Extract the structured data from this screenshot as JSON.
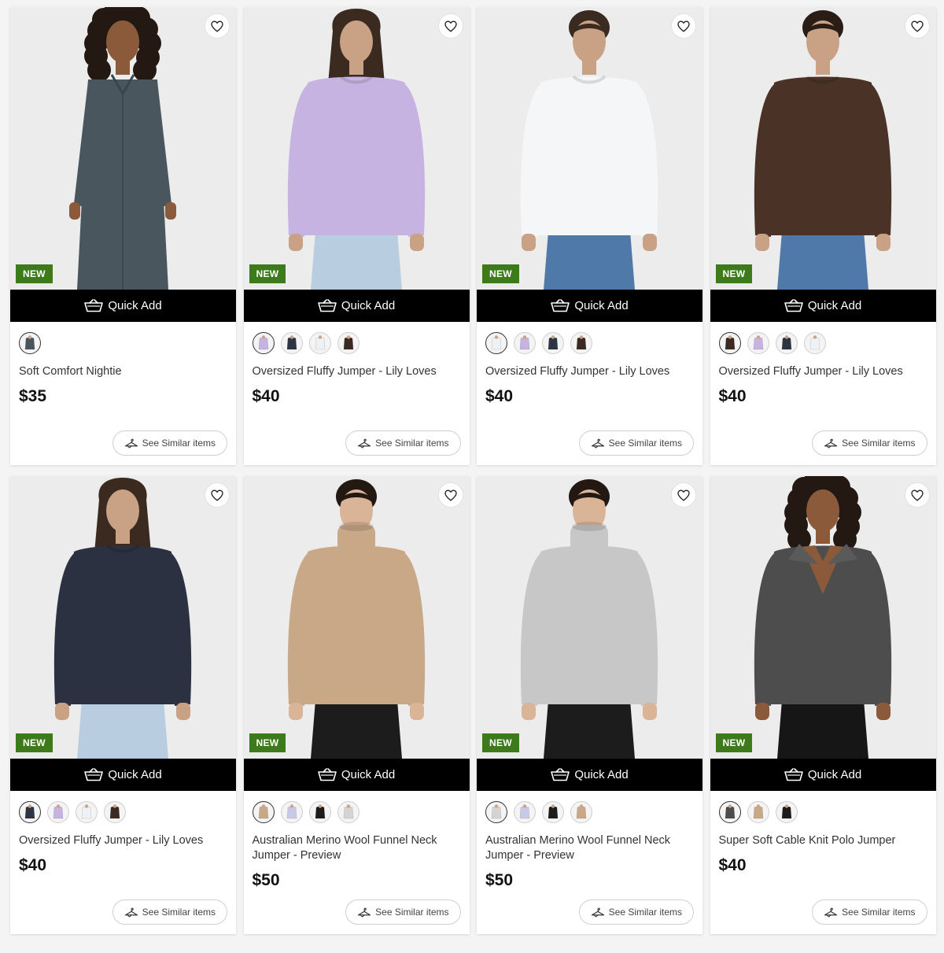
{
  "quick_add_label": "Quick Add",
  "similar_label": "See Similar items",
  "new_label": "NEW",
  "products": [
    {
      "name": "Soft Comfort Nightie",
      "price": "$35",
      "is_new": true,
      "garment": "dress",
      "garment_color": "#4a565e",
      "bottom_color": "#4a565e",
      "skin": "#8a5a3b",
      "hair": "#231812",
      "hair_style": "curly",
      "swatches": [
        "#4a565e"
      ]
    },
    {
      "name": "Oversized Fluffy Jumper - Lily Loves",
      "price": "$40",
      "is_new": true,
      "garment": "sweater",
      "garment_color": "#c6b3e2",
      "bottom_color": "#b9cde0",
      "skin": "#c9a184",
      "hair": "#3b2a20",
      "hair_style": "long",
      "swatches": [
        "#c6b3e2",
        "#2d3543",
        "#eef2f6",
        "#3b2a22"
      ]
    },
    {
      "name": "Oversized Fluffy Jumper - Lily Loves",
      "price": "$40",
      "is_new": true,
      "garment": "sweater",
      "garment_color": "#f5f6f7",
      "bottom_color": "#4f79a8",
      "skin": "#c9a184",
      "hair": "#3b2a20",
      "hair_style": "bun",
      "swatches": [
        "#eef2f6",
        "#c6b3e2",
        "#2d3543",
        "#3b2a22"
      ]
    },
    {
      "name": "Oversized Fluffy Jumper - Lily Loves",
      "price": "$40",
      "is_new": true,
      "garment": "sweater",
      "garment_color": "#4a3326",
      "bottom_color": "#4f79a8",
      "skin": "#c9a184",
      "hair": "#2a1d16",
      "hair_style": "bun",
      "swatches": [
        "#3b2a22",
        "#c6b3e2",
        "#2d3543",
        "#eef2f6"
      ]
    },
    {
      "name": "Oversized Fluffy Jumper - Lily Loves",
      "price": "$40",
      "is_new": true,
      "garment": "sweater",
      "garment_color": "#2b3140",
      "bottom_color": "#b9cde0",
      "skin": "#c9a184",
      "hair": "#3b2a20",
      "hair_style": "long",
      "swatches": [
        "#2d3543",
        "#c6b3e2",
        "#eef2f6",
        "#3b2a22"
      ]
    },
    {
      "name": "Australian Merino Wool Funnel Neck Jumper - Preview",
      "price": "$50",
      "is_new": true,
      "garment": "funnel",
      "garment_color": "#c9a888",
      "bottom_color": "#1c1c1c",
      "skin": "#d9b497",
      "hair": "#231812",
      "hair_style": "bun",
      "swatches": [
        "#c9a888",
        "#c9c8e8",
        "#1c1c1c",
        "#d4d4d4"
      ]
    },
    {
      "name": "Australian Merino Wool Funnel Neck Jumper - Preview",
      "price": "$50",
      "is_new": true,
      "garment": "funnel",
      "garment_color": "#c7c7c7",
      "bottom_color": "#1c1c1c",
      "skin": "#d9b497",
      "hair": "#231812",
      "hair_style": "bun",
      "swatches": [
        "#d4d4d4",
        "#c9c8e8",
        "#1c1c1c",
        "#c9a888"
      ]
    },
    {
      "name": "Super Soft Cable Knit Polo Jumper",
      "price": "$40",
      "is_new": true,
      "garment": "polo",
      "garment_color": "#4d4d4d",
      "bottom_color": "#161616",
      "skin": "#8a5a3b",
      "hair": "#231812",
      "hair_style": "curly",
      "swatches": [
        "#4d4d4d",
        "#c9a888",
        "#1c1c1c"
      ]
    }
  ]
}
